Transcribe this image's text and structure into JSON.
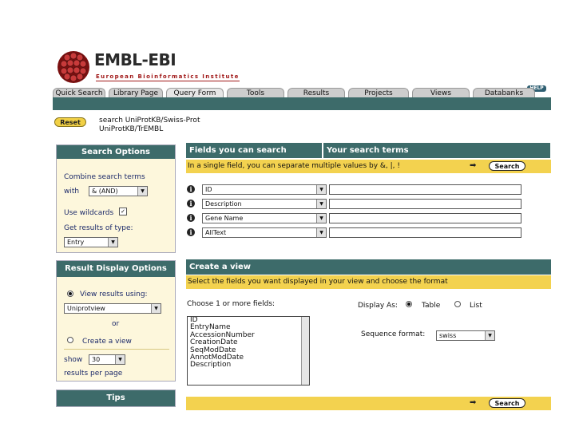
{
  "header": {
    "logo_title": "EMBL-EBI",
    "logo_subtitle": "European Bioinformatics Institute",
    "help_label": "HELP"
  },
  "tabs": [
    {
      "label": "Quick Search"
    },
    {
      "label": "Library Page"
    },
    {
      "label": "Query Form",
      "active": true
    },
    {
      "label": "Tools"
    },
    {
      "label": "Results"
    },
    {
      "label": "Projects"
    },
    {
      "label": "Views"
    },
    {
      "label": "Databanks"
    }
  ],
  "toolbar": {
    "reset_label": "Reset",
    "message_line1": "search UniProtKB/Swiss-Prot",
    "message_line2": "UniProtKB/TrEMBL"
  },
  "search_options": {
    "title": "Search Options",
    "combine_label": "Combine search terms",
    "with_label": "with",
    "with_value": "& (AND)",
    "wildcards_label": "Use wildcards",
    "wildcards_checked": true,
    "results_type_label": "Get results of type:",
    "results_type_value": "Entry"
  },
  "result_display": {
    "title": "Result Display Options",
    "view_results_label": "View results using:",
    "view_value": "Uniprotview",
    "or_label": "or",
    "create_view_label": "Create a view",
    "show_label": "show",
    "show_value": "30",
    "per_page_label": "results per page"
  },
  "tips": {
    "title": "Tips"
  },
  "fields": {
    "header_fields": "Fields you can search",
    "header_terms": "Your search terms",
    "instruction": "In a single field, you can separate multiple values by &, |, !",
    "search_label": "Search",
    "rows": [
      {
        "field": "ID",
        "term": ""
      },
      {
        "field": "Description",
        "term": ""
      },
      {
        "field": "Gene Name",
        "term": ""
      },
      {
        "field": "AllText",
        "term": ""
      }
    ]
  },
  "create_view": {
    "title": "Create a view",
    "instruction": "Select the fields you want displayed in your view and choose the format",
    "choose_label": "Choose 1 or more fields:",
    "field_options": [
      "ID",
      "EntryName",
      "AccessionNumber",
      "CreationDate",
      "SeqModDate",
      "AnnotModDate",
      "Description"
    ],
    "display_as_label": "Display As:",
    "table_label": "Table",
    "list_label": "List",
    "sequence_format_label": "Sequence format:",
    "sequence_format_value": "swiss",
    "search_label": "Search"
  },
  "colors": {
    "teal": "#3d6b6a",
    "yellow": "#f3d24f",
    "panel_bg": "#fdf7dc",
    "brand_red": "#a01818"
  }
}
